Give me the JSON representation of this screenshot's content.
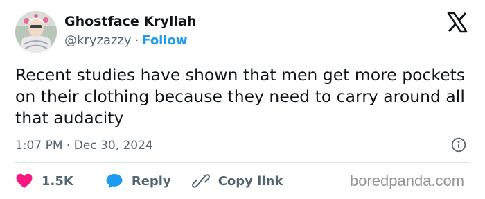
{
  "author": {
    "display_name": "Ghostface Kryllah",
    "handle": "@kryzazzy",
    "separator": "·",
    "follow_label": "Follow"
  },
  "tweet": {
    "text": "Recent studies have shown that men get more pockets on their clothing because they need to carry around all that audacity",
    "timestamp": "1:07 PM · Dec 30, 2024"
  },
  "actions": {
    "like_count": "1.5K",
    "reply_label": "Reply",
    "copy_link_label": "Copy link"
  },
  "watermark": "boredpanda.com",
  "colors": {
    "accent": "#1d9bf0",
    "like": "#f91880",
    "reply": "#1d9bf0",
    "text": "#0f1419",
    "secondary_text": "#536471"
  },
  "icons": {
    "brand": "x-logo-icon",
    "info": "info-icon",
    "like": "heart-icon",
    "reply": "speech-bubble-icon",
    "copy_link": "link-icon"
  }
}
